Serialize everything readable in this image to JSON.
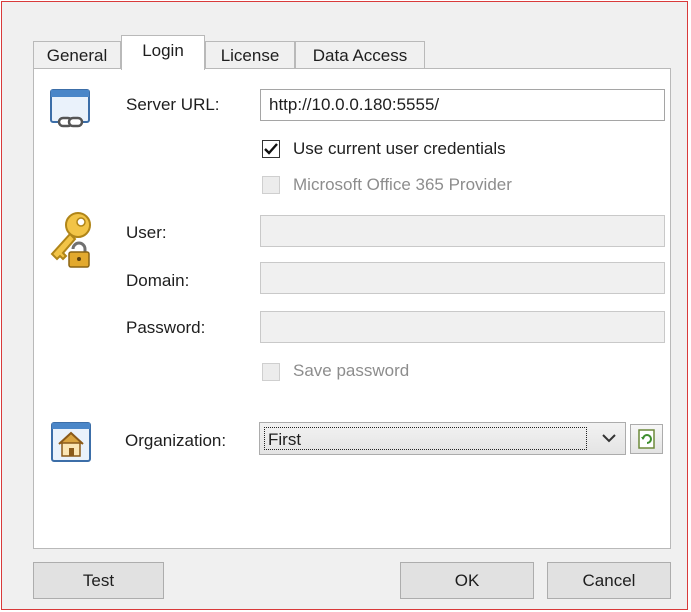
{
  "tabs": [
    {
      "label": "General",
      "active": false
    },
    {
      "label": "Login",
      "active": true
    },
    {
      "label": "License",
      "active": false
    },
    {
      "label": "Data Access",
      "active": false
    }
  ],
  "login": {
    "server_url_label": "Server URL:",
    "server_url_value": "http://10.0.0.180:5555/",
    "use_current_credentials_label": "Use current user credentials",
    "use_current_credentials_checked": true,
    "office365_label": "Microsoft Office 365 Provider",
    "office365_checked": false,
    "user_label": "User:",
    "user_value": "",
    "domain_label": "Domain:",
    "domain_value": "",
    "password_label": "Password:",
    "password_value": "",
    "save_password_label": "Save password",
    "save_password_checked": false,
    "organization_label": "Organization:",
    "organization_value": "First"
  },
  "icons": {
    "server": "server-link-icon",
    "credentials": "key-lock-icon",
    "organization": "house-icon",
    "refresh": "refresh-icon",
    "dropdown": "chevron-down-icon"
  },
  "buttons": {
    "test": "Test",
    "ok": "OK",
    "cancel": "Cancel"
  }
}
